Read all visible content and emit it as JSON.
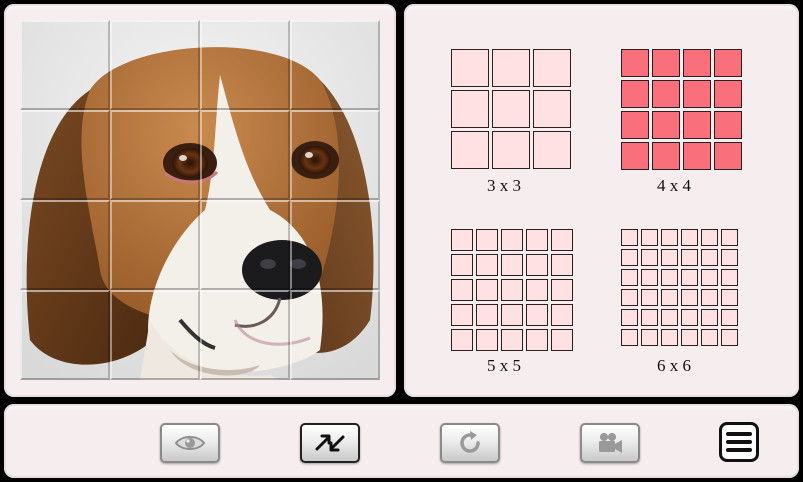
{
  "puzzle": {
    "grid": "4 x 4",
    "rows": 4,
    "cols": 4,
    "image": "beagle-dog-face"
  },
  "grid_options": [
    {
      "label": "3 x 3",
      "size": 3,
      "selected": false
    },
    {
      "label": "4 x 4",
      "size": 4,
      "selected": true
    },
    {
      "label": "5 x 5",
      "size": 5,
      "selected": false
    },
    {
      "label": "6 x 6",
      "size": 6,
      "selected": false
    }
  ],
  "colors": {
    "cell_unselected": "#ffe1e3",
    "cell_selected": "#f9707c",
    "panel": "#f6eeee"
  },
  "toolbar": {
    "buttons": [
      {
        "icon": "eye-icon",
        "action": "preview"
      },
      {
        "icon": "shuffle-swap-icon",
        "action": "swap",
        "active": true
      },
      {
        "icon": "rotate-icon",
        "action": "rotate"
      },
      {
        "icon": "video-camera-icon",
        "action": "video"
      },
      {
        "icon": "hamburger-menu-icon",
        "action": "menu"
      }
    ]
  }
}
